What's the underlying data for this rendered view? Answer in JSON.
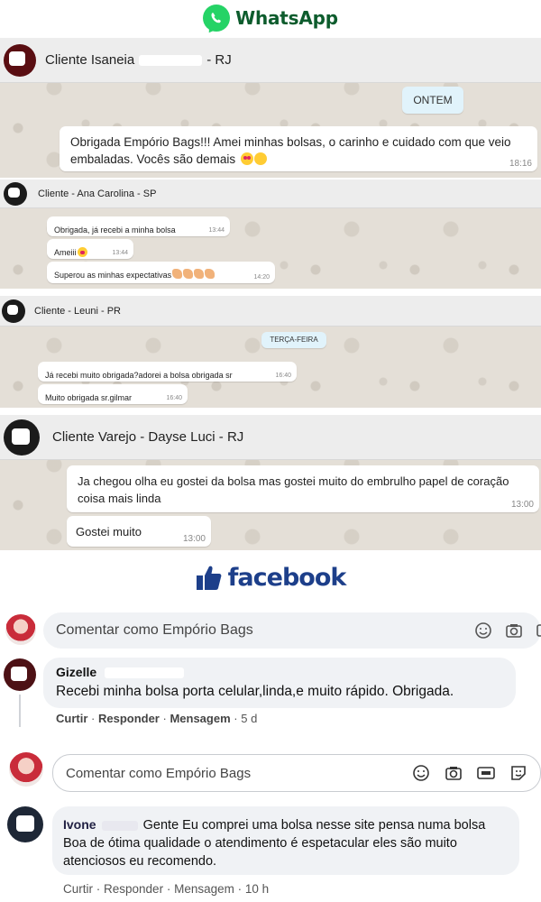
{
  "whatsapp": {
    "brand": "WhatsApp",
    "chats": [
      {
        "contact": "Cliente Isaneia",
        "contact_suffix": "- RJ",
        "date": "ONTEM",
        "messages": [
          {
            "text": "Obrigada Empório Bags!!! Amei minhas bolsas, o carinho e cuidado com que veio embaladas. Vocês são demais",
            "time": "18:16"
          }
        ]
      },
      {
        "contact": "Cliente - Ana Carolina - SP",
        "messages": [
          {
            "text": "Obrigada, já recebi a minha bolsa",
            "time": "13:44"
          },
          {
            "text": "Ameiii",
            "time": "13:44"
          },
          {
            "text": "Superou as minhas expectativas",
            "time": "14:20"
          }
        ]
      },
      {
        "contact": "Cliente - Leuni - PR",
        "date": "TERÇA-FEIRA",
        "messages": [
          {
            "text": "Já recebi muito obrigada?adorei a bolsa obrigada sr",
            "time": "16:40"
          },
          {
            "text": "Muito obrigada sr.gilmar",
            "time": "16:40"
          }
        ]
      },
      {
        "contact": "Cliente Varejo - Dayse Luci - RJ",
        "messages": [
          {
            "text": "Ja chegou olha eu gostei da bolsa mas gostei muito do embrulho papel de coração coisa mais linda",
            "time": "13:00"
          },
          {
            "text": "Gostei muito",
            "time": "13:00"
          }
        ]
      }
    ]
  },
  "facebook": {
    "brand": "facebook",
    "comment_placeholder": "Comentar como Empório Bags",
    "comments": [
      {
        "author": "Gizelle",
        "text": "Recebi minha bolsa porta celular,linda,e muito rápido. Obrigada.",
        "actions": {
          "like": "Curtir",
          "reply": "Responder",
          "message": "Mensagem",
          "age": "5 d"
        }
      },
      {
        "author": "Ivone",
        "text": "Gente Eu comprei uma bolsa nesse site pensa numa bolsa Boa de ótima qualidade o atendimento é espetacular eles são muito atenciosos eu recomendo.",
        "actions": {
          "like": "Curtir",
          "reply": "Responder",
          "message": "Mensagem",
          "age": "10 h"
        }
      }
    ]
  },
  "colors": {
    "whatsapp_green": "#25d366",
    "facebook_blue": "#1d3f8a",
    "chat_bg": "#e4dfd7",
    "date_pill": "#e1f3fb"
  },
  "icons": [
    "whatsapp-logo-icon",
    "facebook-thumbs-up-icon",
    "emoji-icon",
    "camera-icon",
    "gif-icon",
    "sticker-icon"
  ]
}
